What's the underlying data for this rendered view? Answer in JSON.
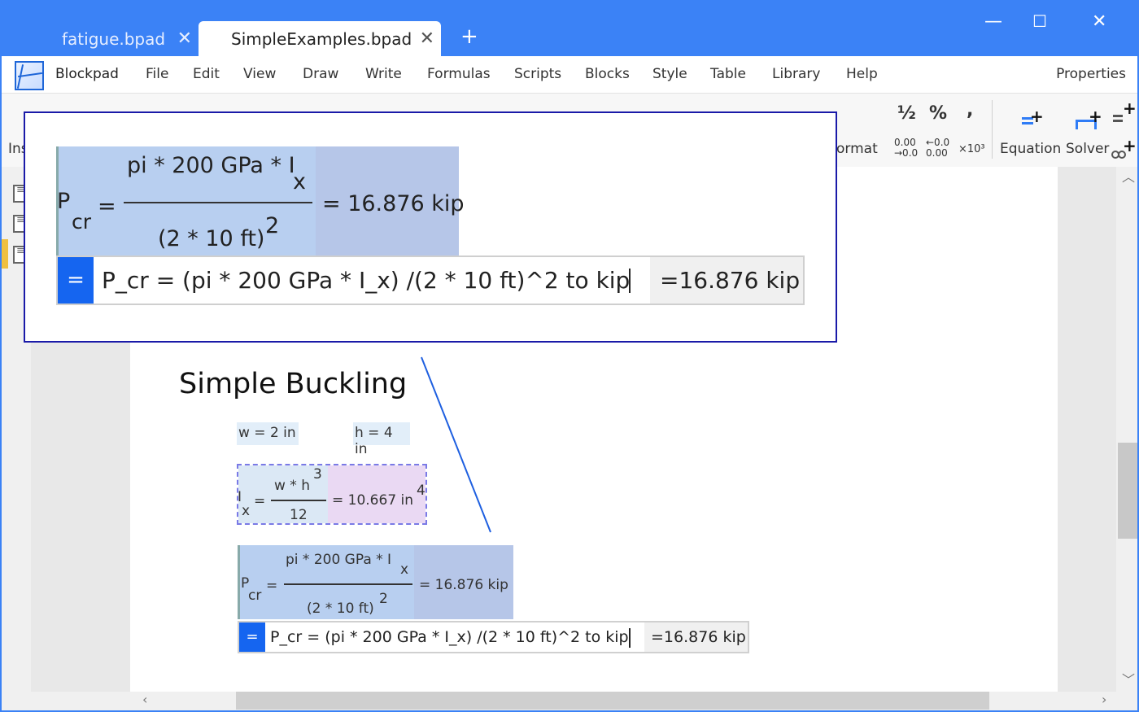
{
  "tabs": [
    {
      "label": "fatigue.bpad",
      "active": false
    },
    {
      "label": "SimpleExamples.bpad",
      "active": true
    }
  ],
  "tab_close_glyph": "✕",
  "new_tab_glyph": "+",
  "window_controls": {
    "minimize": "—",
    "maximize": "☐",
    "close": "✕"
  },
  "app_name": "Blockpad",
  "menu": [
    "File",
    "Edit",
    "View",
    "Draw",
    "Write",
    "Formulas",
    "Scripts",
    "Blocks",
    "Style",
    "Table",
    "Library",
    "Help"
  ],
  "properties_label": "Properties",
  "ribbon": {
    "insert_partial": "Ins",
    "format_partial": "ormat",
    "fraction_glyph": "½",
    "percent_glyph": "%",
    "comma_glyph": ",",
    "decimal_more_top": "0.00",
    "decimal_more_bottom": "→0.0",
    "decimal_less_top": "←0.0",
    "decimal_less_bottom": "0.00",
    "sci_notation": "×10³",
    "equation_label": "Equation",
    "solver_label": "Solver",
    "accent_color": "#2f7cf6"
  },
  "document": {
    "heading": "Simple Buckling",
    "vars": [
      {
        "name": "w = 2 in"
      },
      {
        "name": "h = 4 in"
      }
    ],
    "ix": {
      "lhs": "I",
      "lhs_sub": "x",
      "eq": "=",
      "numerator": "w * h",
      "numerator_exp": "3",
      "denominator": "12",
      "result": "= 10.667 in",
      "result_exp": "4"
    },
    "pcr": {
      "lhs": "P",
      "lhs_sub": "cr",
      "eq": "=",
      "numerator": "pi * 200 GPa * I",
      "numerator_sub": "x",
      "denominator": "(2 * 10 ft)",
      "denominator_exp": "2",
      "result": "= 16.876 kip"
    },
    "input": {
      "button": "=",
      "formula": "P_cr = (pi * 200 GPa * I_x) /(2 * 10 ft)^2 to kip",
      "result": "=16.876 kip"
    }
  }
}
